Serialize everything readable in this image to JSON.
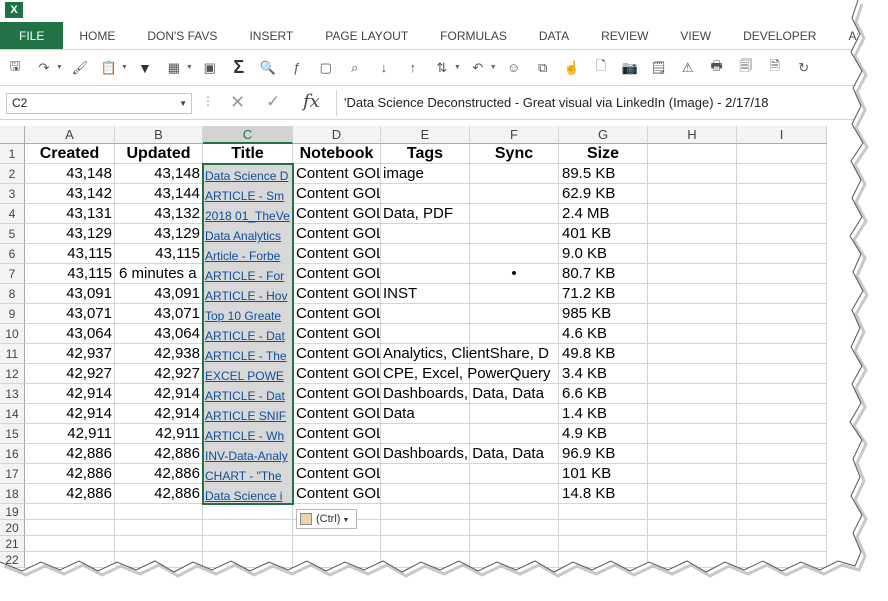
{
  "app": {
    "logo_text": "X"
  },
  "tabs": [
    "FILE",
    "HOME",
    "DON'S FAVS",
    "INSERT",
    "PAGE LAYOUT",
    "FORMULAS",
    "DATA",
    "REVIEW",
    "VIEW",
    "DEVELOPER",
    "ASAP Utilities"
  ],
  "toolbar_icons": [
    "save-icon",
    "redo-icon",
    "format-painter-icon",
    "paste-special-icon",
    "filter-icon",
    "table-style-icon",
    "paste-values-icon",
    "autosum-icon",
    "find-icon",
    "insert-function-icon",
    "new-sheet-icon",
    "lookup-icon",
    "sort-ascending-icon",
    "sort-descending-icon",
    "sort-custom-icon",
    "undo-icon",
    "smiley-icon",
    "copy-format-icon",
    "touch-icon",
    "new-document-icon",
    "camera-icon",
    "notes-icon",
    "warning-icon",
    "print-icon",
    "print-preview-icon",
    "print-setup-icon",
    "refresh-icon"
  ],
  "formula_bar": {
    "name_box": "C2",
    "fx_label": "fx",
    "formula": "'Data Science Deconstructed - Great visual via LinkedIn (Image) - 2/17/18"
  },
  "columns": [
    "A",
    "B",
    "C",
    "D",
    "E",
    "F",
    "G",
    "H",
    "I"
  ],
  "selected_column": "C",
  "header_row": [
    "Created",
    "Updated",
    "Title",
    "Notebook",
    "Tags",
    "Sync",
    "Size"
  ],
  "rows": [
    [
      "43,148",
      "43,148",
      "Data Science D",
      "Content GOLD",
      "image",
      "",
      "89.5 KB"
    ],
    [
      "43,142",
      "43,144",
      "ARTICLE - Sm",
      "Content GOLD",
      "",
      "",
      "62.9 KB"
    ],
    [
      "43,131",
      "43,132",
      "2018 01_TheVe",
      "Content GOL",
      "Data, PDF",
      "",
      "2.4 MB"
    ],
    [
      "43,129",
      "43,129",
      "Data Analytics",
      "Content GOLD",
      "",
      "",
      "401 KB"
    ],
    [
      "43,115",
      "43,115",
      "Article - Forbe",
      "Content GOLD",
      "",
      "",
      "9.0 KB"
    ],
    [
      "43,115",
      "6 minutes a",
      "ARTICLE - For",
      "Content GOLD",
      "",
      "•",
      "80.7 KB"
    ],
    [
      "43,091",
      "43,091",
      "ARTICLE - Hov",
      "Content GOL",
      "INST",
      "",
      "71.2 KB"
    ],
    [
      "43,071",
      "43,071",
      "Top 10 Greate",
      "Content GOLD",
      "",
      "",
      "985 KB"
    ],
    [
      "43,064",
      "43,064",
      "ARTICLE - Dat",
      "Content GOLD",
      "",
      "",
      "4.6 KB"
    ],
    [
      "42,937",
      "42,938",
      "ARTICLE - The",
      "Content GOL",
      "Analytics, ClientShare, D",
      "",
      "49.8 KB"
    ],
    [
      "42,927",
      "42,927",
      "EXCEL POWE",
      "Content GOL",
      "CPE, Excel, PowerQuery",
      "",
      "3.4 KB"
    ],
    [
      "42,914",
      "42,914",
      "ARTICLE - Dat",
      "Content GOL",
      "Dashboards, Data, Data",
      "",
      "6.6 KB"
    ],
    [
      "42,914",
      "42,914",
      "ARTICLE SNIF",
      "Content GOL",
      "Data",
      "",
      "1.4 KB"
    ],
    [
      "42,911",
      "42,911",
      "ARTICLE - Wh",
      "Content GOLD",
      "",
      "",
      "4.9 KB"
    ],
    [
      "42,886",
      "42,886",
      "INV-Data-Analy",
      "Content GOL",
      "Dashboards, Data, Data",
      "",
      "96.9 KB"
    ],
    [
      "42,886",
      "42,886",
      "CHART - \"The",
      "Content GOLD",
      "",
      "",
      "101 KB"
    ],
    [
      "42,886",
      "42,886",
      "Data Science i",
      "Content GOLD",
      "",
      "",
      "14.8 KB"
    ]
  ],
  "row_numbers": [
    "1",
    "2",
    "3",
    "4",
    "5",
    "6",
    "7",
    "8",
    "9",
    "10",
    "11",
    "12",
    "13",
    "14",
    "15",
    "16",
    "17",
    "18",
    "19",
    "20",
    "21",
    "22"
  ],
  "paste_options_label": "(Ctrl)"
}
